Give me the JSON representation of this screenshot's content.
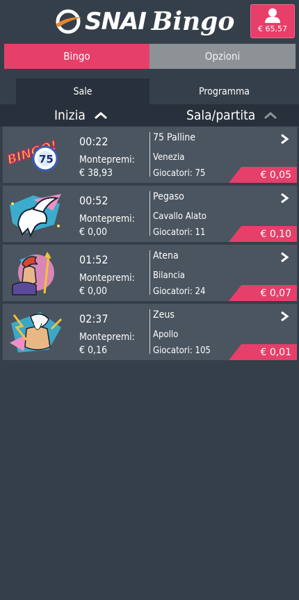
{
  "header": {
    "logo_word_1": "SNAI",
    "logo_word_2": "Bingo",
    "account_balance": "€ 65,57",
    "user_icon": "user-icon"
  },
  "top_tabs": [
    {
      "label": "Bingo",
      "active": true
    },
    {
      "label": "Opzioni",
      "active": false
    }
  ],
  "sub_tabs": [
    {
      "label": "Sale",
      "active": true
    },
    {
      "label": "Programma",
      "active": false
    }
  ],
  "sort_bar": {
    "start_label": "Inizia",
    "hall_label": "Sala/partita"
  },
  "rooms": [
    {
      "time": "00:22",
      "pool_label": "Montepremi:",
      "pool": "€ 38,93",
      "name": "75 Palline",
      "subtitle": "Venezia",
      "players": "Giocatori: 75",
      "price": "€ 0,05",
      "art": "bingo-75-ball-art"
    },
    {
      "time": "00:52",
      "pool_label": "Montepremi:",
      "pool": "€ 0,00",
      "name": "Pegaso",
      "subtitle": "Cavallo Alato",
      "players": "Giocatori: 11",
      "price": "€ 0,10",
      "art": "pegasus-art"
    },
    {
      "time": "01:52",
      "pool_label": "Montepremi:",
      "pool": "€ 0,00",
      "name": "Atena",
      "subtitle": "Bilancia",
      "players": "Giocatori: 24",
      "price": "€ 0,07",
      "art": "athena-art"
    },
    {
      "time": "02:37",
      "pool_label": "Montepremi:",
      "pool": "€ 0,16",
      "name": "Zeus",
      "subtitle": "Apollo",
      "players": "Giocatori: 105",
      "price": "€ 0,01",
      "art": "zeus-art"
    }
  ],
  "colors": {
    "background": "#353f4a",
    "accent": "#e63f6a",
    "card": "#4a5560",
    "sort_bar": "#28313b",
    "inactive_tab": "#8d9296"
  }
}
